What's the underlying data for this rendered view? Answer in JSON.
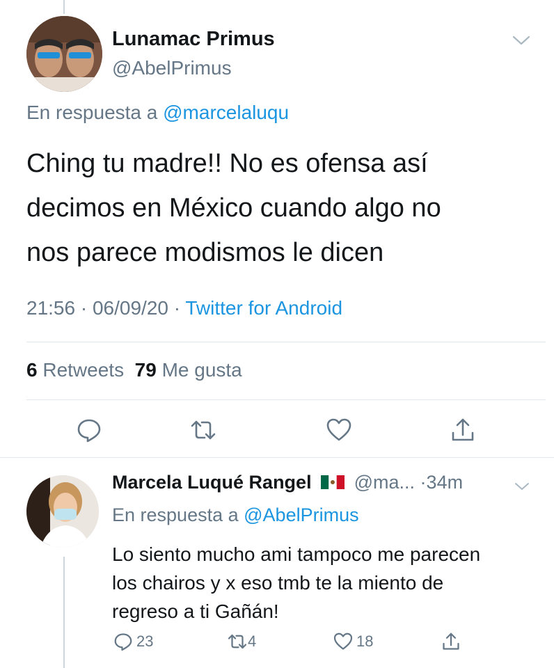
{
  "main_tweet": {
    "author_name": "Lunamac Primus",
    "author_handle": "@AbelPrimus",
    "reply_prefix": "En respuesta a",
    "reply_mention": "@marcelaluqu",
    "text_lines": [
      "Ching tu madre!! No es ofensa así",
      "decimos en México cuando algo no",
      "nos parece modismos le dicen"
    ],
    "time": "21:56",
    "date": "06/09/20",
    "separator": "·",
    "source": "Twitter for Android",
    "retweets_count": "6",
    "retweets_label": "Retweets",
    "likes_count": "79",
    "likes_label": "Me gusta",
    "icons": [
      "chevron-down-icon",
      "reply-icon",
      "retweet-icon",
      "like-icon",
      "share-icon"
    ]
  },
  "reply_tweet": {
    "author_name": "Marcela Luqué Rangel",
    "author_flag": "mexico-flag-icon",
    "author_handle": "@ma...",
    "time_ago": "34m",
    "separator": "·",
    "reply_prefix": "En respuesta a",
    "reply_mention": "@AbelPrimus",
    "text_lines": [
      "Lo siento mucho ami tampoco me parecen",
      "los chairos y x eso tmb te la miento de",
      "regreso a ti Gañán!"
    ],
    "reply_count": "23",
    "retweet_count": "4",
    "like_count": "18"
  },
  "colors": {
    "text": "#14171a",
    "secondary": "#657786",
    "link": "#1b95e0",
    "divider": "#e1e8ed"
  }
}
